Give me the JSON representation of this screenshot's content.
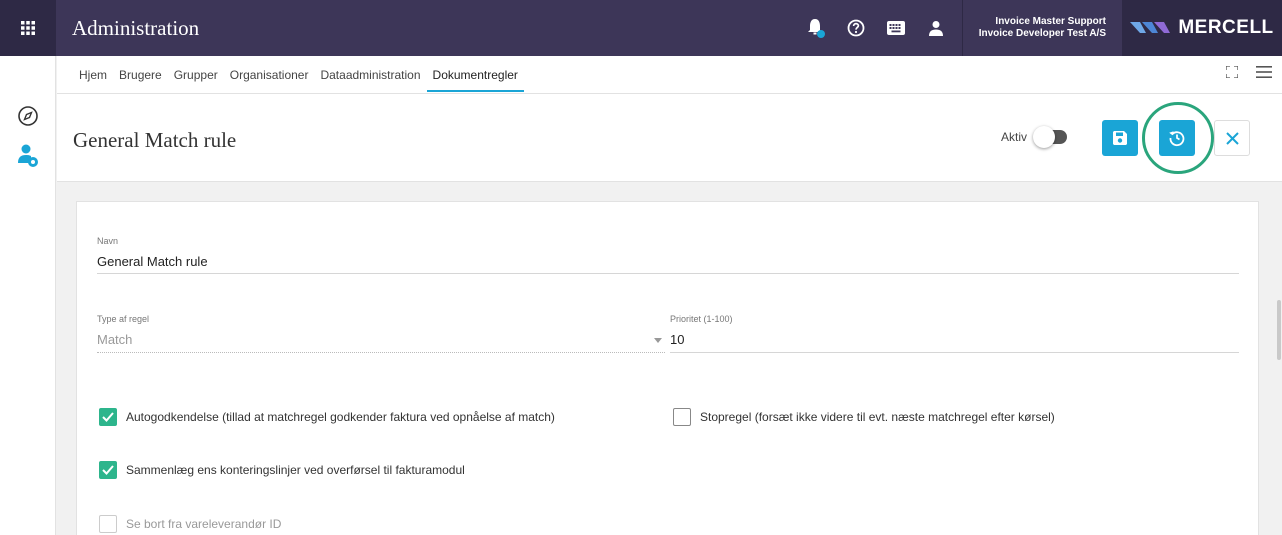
{
  "header": {
    "title": "Administration",
    "user_line1": "Invoice Master Support",
    "user_line2": "Invoice Developer Test A/S",
    "brand": "MERCELL"
  },
  "icons": {
    "apps": "apps-grid-icon",
    "bell": "bell-icon",
    "help": "help-circle-icon",
    "keyboard": "keyboard-icon",
    "user": "user-icon",
    "compass": "compass-icon",
    "user_settings": "user-settings-icon",
    "fullscreen": "fullscreen-icon",
    "menu": "hamburger-menu-icon",
    "save": "save-icon",
    "history": "history-icon",
    "close": "close-icon"
  },
  "nav": {
    "tabs": [
      "Hjem",
      "Brugere",
      "Grupper",
      "Organisationer",
      "Dataadministration",
      "Dokumentregler"
    ],
    "active_tab": "Dokumentregler"
  },
  "page": {
    "title": "General Match rule",
    "aktiv_label": "Aktiv",
    "aktiv_on": false
  },
  "form": {
    "navn": {
      "label": "Navn",
      "value": "General Match rule"
    },
    "type": {
      "label": "Type af regel",
      "value": "Match"
    },
    "priority": {
      "label": "Prioritet (1-100)",
      "value": "10"
    },
    "checkboxes": [
      {
        "label": "Autogodkendelse (tillad at matchregel godkender faktura ved opnåelse af match)",
        "checked": true,
        "disabled": false
      },
      {
        "label": "Stopregel (forsæt ikke videre til evt. næste matchregel efter kørsel)",
        "checked": false,
        "disabled": false
      },
      {
        "label": "Sammenlæg ens konteringslinjer ved overførsel til fakturamodul",
        "checked": true,
        "disabled": false
      },
      {
        "label": "Se bort fra vareleverandør ID",
        "checked": false,
        "disabled": true
      }
    ]
  },
  "colors": {
    "topbar": "#3d3658",
    "accent": "#1aa5d6",
    "check": "#2db58c",
    "highlight_ring": "#2aa57c"
  }
}
